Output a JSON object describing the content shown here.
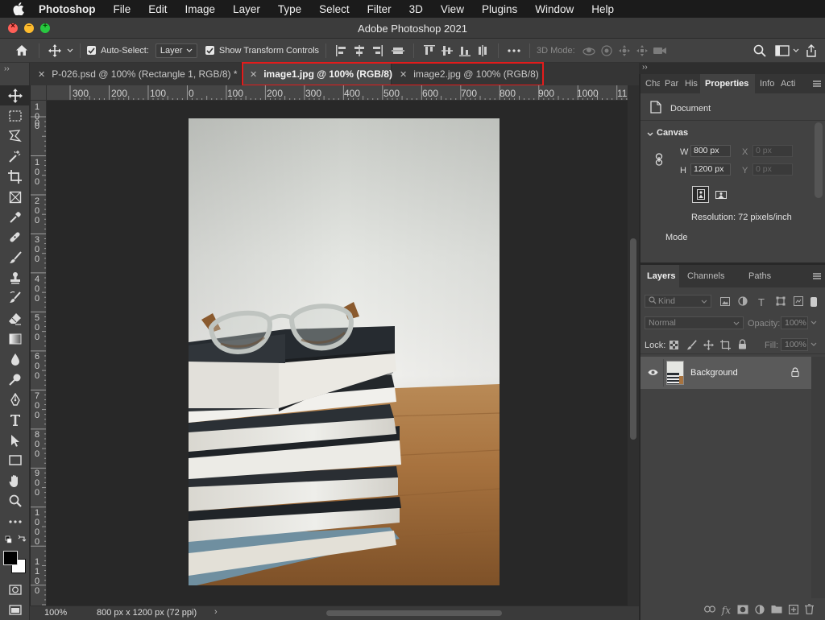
{
  "menubar": {
    "items": [
      "Photoshop",
      "File",
      "Edit",
      "Image",
      "Layer",
      "Type",
      "Select",
      "Filter",
      "3D",
      "View",
      "Plugins",
      "Window",
      "Help"
    ]
  },
  "window": {
    "title": "Adobe Photoshop 2021"
  },
  "options": {
    "auto_select_label": "Auto-Select:",
    "auto_select_value": "Layer",
    "transform_label": "Show Transform Controls",
    "mode_label": "3D Mode:"
  },
  "toolbar": {
    "collapse": "››"
  },
  "tabs": [
    {
      "label": "P-026.psd @ 100% (Rectangle 1, RGB/8) *"
    },
    {
      "label": "image1.jpg @ 100% (RGB/8)"
    },
    {
      "label": "image2.jpg @ 100% (RGB/8)"
    }
  ],
  "ruler": {
    "h": [
      "300",
      "200",
      "100",
      "0",
      "100",
      "200",
      "300",
      "400",
      "500",
      "600",
      "700",
      "800",
      "900",
      "1000",
      "11"
    ],
    "v": [
      "1\n0\n0",
      "0",
      "1\n0\n0",
      "2\n0\n0",
      "3\n0\n0",
      "4\n0\n0",
      "5\n0\n0",
      "6\n0\n0",
      "7\n0\n0",
      "8\n0\n0",
      "9\n0\n0",
      "1\n0\n0\n0",
      "1\n1\n0\n0"
    ]
  },
  "status": {
    "zoom": "100%",
    "doc": "800 px x 1200 px (72 ppi)",
    "arrow": "›"
  },
  "right_strip": {
    "collapse": "››"
  },
  "properties": {
    "tabs": [
      "Cha",
      "Par",
      "His",
      "Properties",
      "Info",
      "Acti"
    ],
    "doc_label": "Document",
    "section": "Canvas",
    "w_label": "W",
    "w_value": "800 px",
    "h_label": "H",
    "h_value": "1200 px",
    "x_label": "X",
    "x_value": "0 px",
    "y_label": "Y",
    "y_value": "0 px",
    "resolution": "Resolution: 72 pixels/inch",
    "mode_label": "Mode"
  },
  "layers": {
    "tabs": [
      "Layers",
      "Channels",
      "Paths"
    ],
    "kind_placeholder": "Kind",
    "blend": "Normal",
    "opacity_label": "Opacity:",
    "opacity_value": "100%",
    "lock_label": "Lock:",
    "fill_label": "Fill:",
    "fill_value": "100%",
    "layer_name": "Background",
    "fx": "fx"
  },
  "colors": {
    "highlight": "#e31b1b",
    "close": "#ff5f57",
    "minimize": "#febc2e",
    "maximize": "#28c840"
  }
}
